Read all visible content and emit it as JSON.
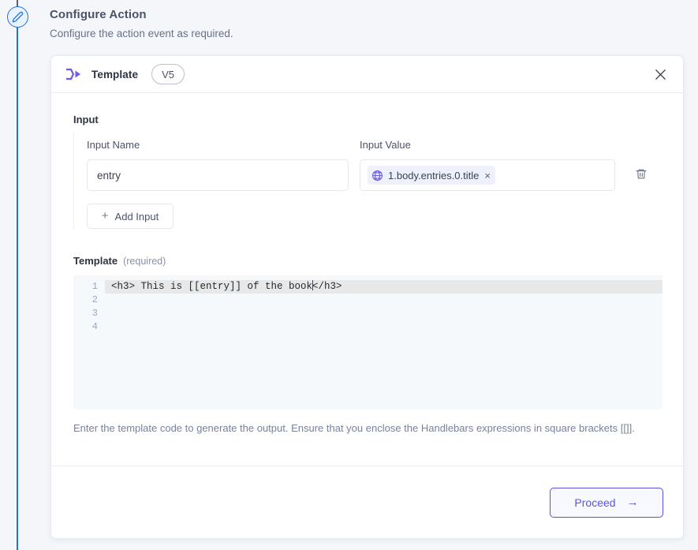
{
  "rail": {
    "node_icon": "pencil-edit-icon"
  },
  "header": {
    "title": "Configure Action",
    "subtitle": "Configure the action event as required."
  },
  "card": {
    "icon": "template-arrow-icon",
    "title": "Template",
    "version_badge": "V5",
    "close_icon": "close-icon"
  },
  "input_section": {
    "section_label": "Input",
    "name_label": "Input Name",
    "value_label": "Input Value",
    "name_value": "entry",
    "name_placeholder": "Input Name",
    "chip": {
      "icon": "globe-icon",
      "text": "1.body.entries.0.title",
      "remove_icon": "×"
    },
    "delete_icon": "trash-icon",
    "add_input_label": "Add Input",
    "add_input_plus": "+"
  },
  "template_section": {
    "label": "Template",
    "required_hint": "(required)",
    "line_numbers": [
      "1",
      "2",
      "3",
      "4"
    ],
    "code_lines": [
      {
        "before_caret": "<h3> This is [[entry]] of the book",
        "after_caret": "</h3>",
        "active": true
      },
      {
        "before_caret": "",
        "after_caret": "",
        "active": false
      },
      {
        "before_caret": "",
        "after_caret": "",
        "active": false
      },
      {
        "before_caret": "",
        "after_caret": "",
        "active": false
      }
    ],
    "code_line_1_before": "<h3> This is [[entry]] of the book",
    "code_line_1_after": "</h3>",
    "helper_text": "Enter the template code to generate the output. Ensure that you enclose the Handlebars expressions in square brackets [[]]."
  },
  "footer": {
    "proceed_label": "Proceed",
    "proceed_arrow": "→"
  },
  "colors": {
    "accent_purple": "#5b53e0",
    "rail_blue": "#1a73e8",
    "page_bg": "#f4f6fa",
    "chip_bg": "#eef1fb",
    "editor_bg": "#f6f9fc"
  }
}
